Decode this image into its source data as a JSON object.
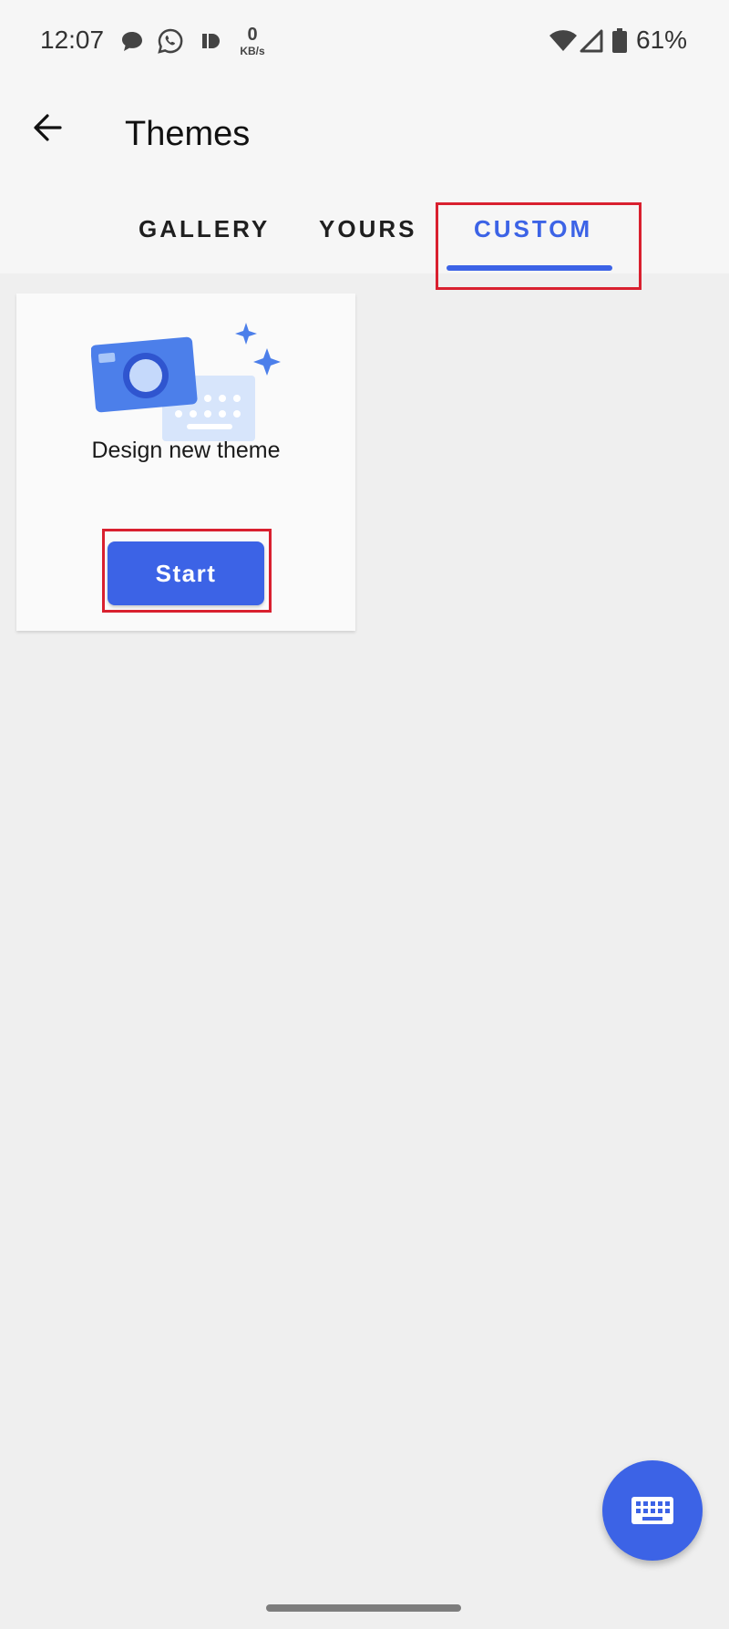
{
  "status_bar": {
    "time": "12:07",
    "net_speed_value": "0",
    "net_speed_unit": "KB/s",
    "battery_percent": "61%",
    "icons": [
      "chat-bubble-icon",
      "whatsapp-icon",
      "pandora-icon",
      "wifi-icon",
      "signal-icon",
      "battery-icon"
    ]
  },
  "header": {
    "title": "Themes",
    "back_icon": "arrow-back-icon"
  },
  "tabs": [
    {
      "label": "GALLERY",
      "selected": false
    },
    {
      "label": "YOURS",
      "selected": false
    },
    {
      "label": "CUSTOM",
      "selected": true
    }
  ],
  "card": {
    "text": "Design new theme",
    "button_label": "Start",
    "illustration": "camera-keyboard-illustration"
  },
  "fab": {
    "icon": "keyboard-icon"
  },
  "colors": {
    "accent": "#3c63e6",
    "highlight_box": "#d9202f",
    "background": "#efefef"
  }
}
